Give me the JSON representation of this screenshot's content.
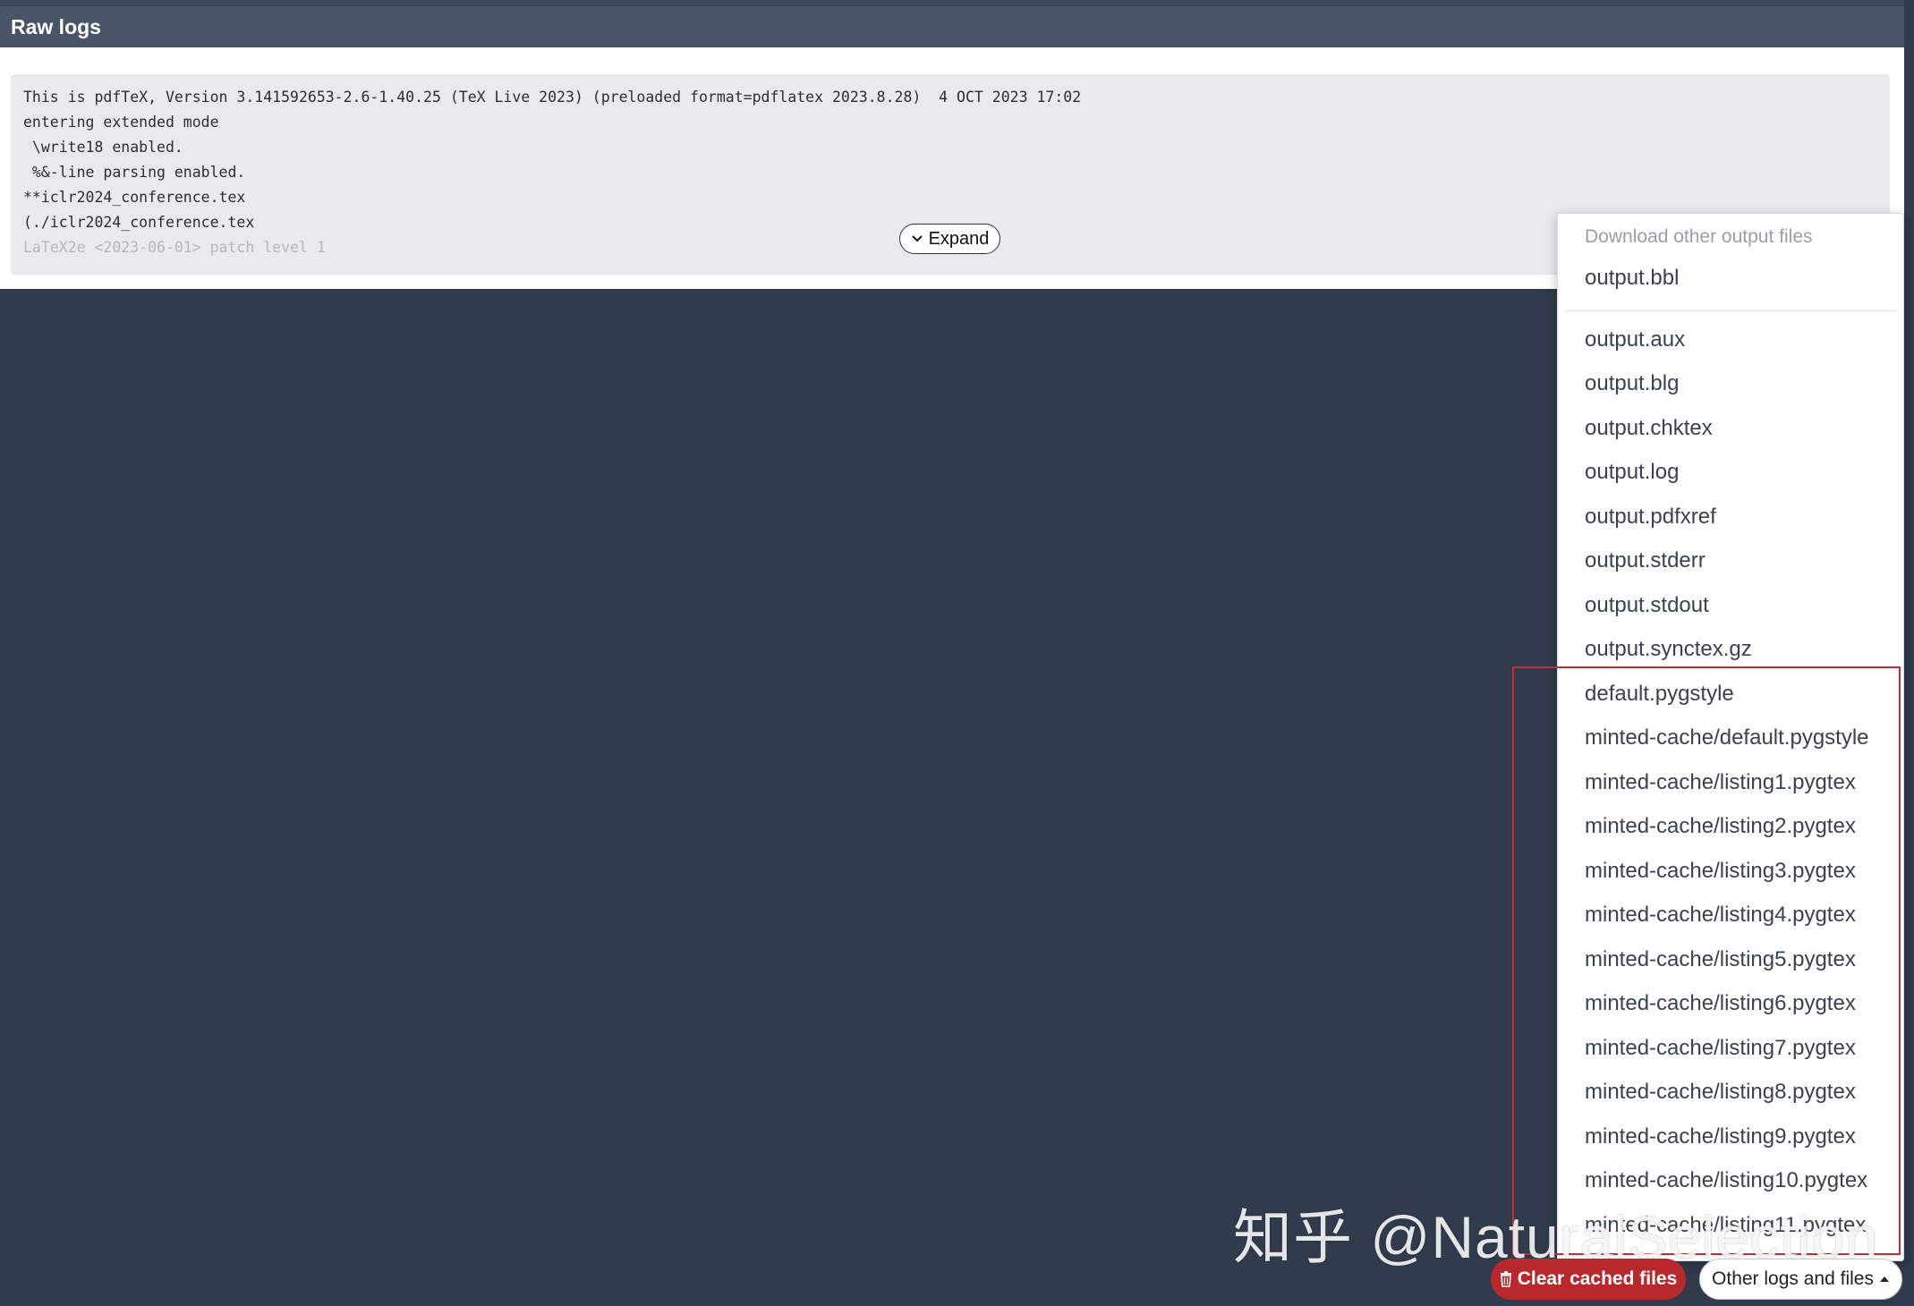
{
  "header": {
    "title": "Raw logs"
  },
  "log": {
    "lines": [
      "This is pdfTeX, Version 3.141592653-2.6-1.40.25 (TeX Live 2023) (preloaded format=pdflatex 2023.8.28)  4 OCT 2023 17:02",
      "entering extended mode",
      " \\write18 enabled.",
      " %&-line parsing enabled.",
      "**iclr2024_conference.tex",
      "(./iclr2024_conference.tex",
      "LaTeX2e <2023-06-01> patch level 1"
    ],
    "expand_label": "Expand"
  },
  "dropdown": {
    "header": "Download other output files",
    "primary_item": "output.bbl",
    "items": [
      "output.aux",
      "output.blg",
      "output.chktex",
      "output.log",
      "output.pdfxref",
      "output.stderr",
      "output.stdout",
      "output.synctex.gz",
      "default.pygstyle",
      "minted-cache/default.pygstyle",
      "minted-cache/listing1.pygtex",
      "minted-cache/listing2.pygtex",
      "minted-cache/listing3.pygtex",
      "minted-cache/listing4.pygtex",
      "minted-cache/listing5.pygtex",
      "minted-cache/listing6.pygtex",
      "minted-cache/listing7.pygtex",
      "minted-cache/listing8.pygtex",
      "minted-cache/listing9.pygtex",
      "minted-cache/listing10.pygtex",
      "minted-cache/listing11.pygtex"
    ]
  },
  "footer": {
    "clear_label": "Clear cached files",
    "other_label": "Other logs and files"
  },
  "watermark": "知乎 @NaturalSelection",
  "colors": {
    "background": "#313b4c",
    "header": "#4a5468",
    "clear_button": "#b9282c",
    "highlight": "#c82d36"
  },
  "icons": {
    "expand": "chevron-down-icon",
    "clear": "trash-icon",
    "other": "caret-up-icon"
  }
}
